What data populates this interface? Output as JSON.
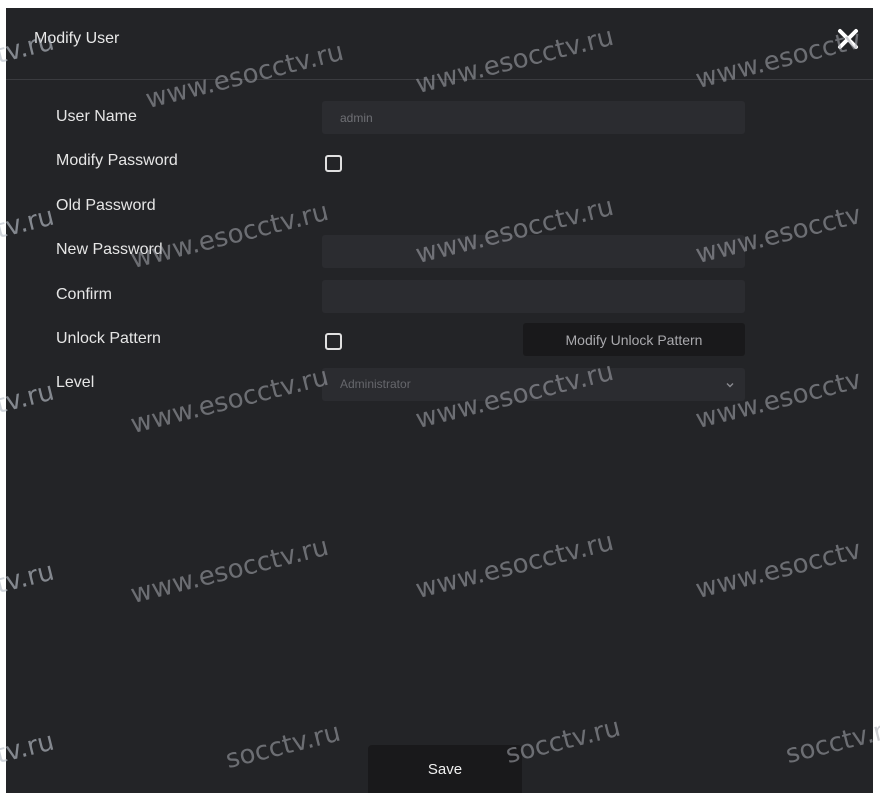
{
  "dialog": {
    "title": "Modify User",
    "close_icon": "close-icon"
  },
  "form": {
    "user_name_label": "User Name",
    "user_name_value": "admin",
    "modify_password_label": "Modify Password",
    "modify_password_checked": false,
    "old_password_label": "Old Password",
    "new_password_label": "New Password",
    "new_password_value": "",
    "confirm_label": "Confirm",
    "confirm_value": "",
    "unlock_pattern_label": "Unlock Pattern",
    "unlock_pattern_checked": false,
    "modify_unlock_pattern_button": "Modify Unlock Pattern",
    "level_label": "Level",
    "level_value": "Administrator",
    "level_chevron_icon": "chevron-down-icon"
  },
  "footer": {
    "save_label": "Save"
  },
  "watermark": {
    "text": "www.esocctv.ru",
    "fragment_left": "tv.ru",
    "fragment_bottom": "socctv.ru",
    "fragment_right": "www.esocctv"
  },
  "colors": {
    "dialog_bg": "#232427",
    "field_bg": "#2b2c30",
    "button_bg": "#19191b",
    "text": "#e6e6e6"
  }
}
